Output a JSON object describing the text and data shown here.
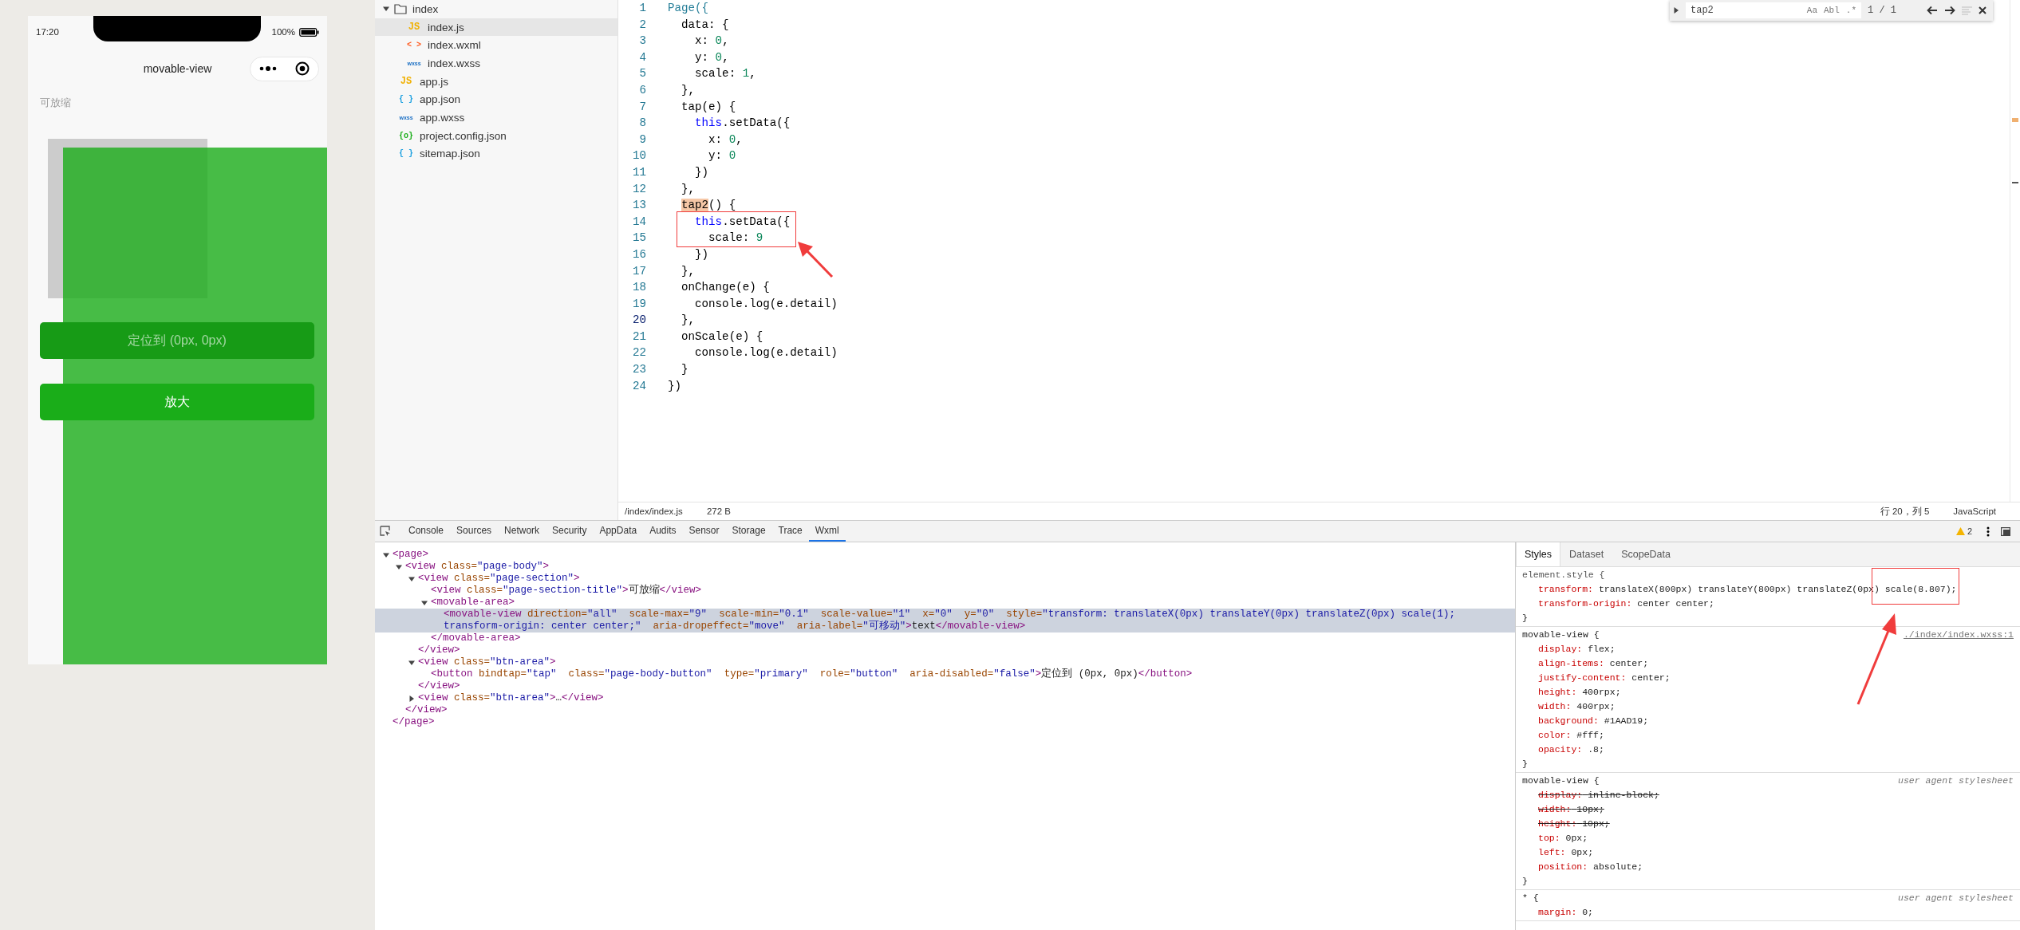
{
  "simulator": {
    "status_bar": {
      "time": "17:20",
      "battery": "100%"
    },
    "nav_title": "movable-view",
    "section_title": "可放缩",
    "buttons": [
      {
        "label": "定位到 (0px, 0px)",
        "pressed": true
      },
      {
        "label": "放大",
        "pressed": false
      }
    ]
  },
  "file_tree": [
    {
      "name": "index",
      "kind": "folder",
      "expanded": true,
      "selected": false,
      "children": [
        {
          "name": "index.js",
          "kind": "js",
          "glyph": "JS",
          "selected": true
        },
        {
          "name": "index.wxml",
          "kind": "wxml",
          "glyph": "< >",
          "selected": false
        },
        {
          "name": "index.wxss",
          "kind": "wxss",
          "glyph": "wxss",
          "selected": false
        }
      ]
    },
    {
      "name": "app.js",
      "kind": "js",
      "glyph": "JS",
      "selected": false
    },
    {
      "name": "app.json",
      "kind": "json",
      "glyph": "{ }",
      "selected": false
    },
    {
      "name": "app.wxss",
      "kind": "wxss",
      "glyph": "wxss",
      "selected": false
    },
    {
      "name": "project.config.json",
      "kind": "config",
      "glyph": "{o}",
      "selected": false
    },
    {
      "name": "sitemap.json",
      "kind": "json",
      "glyph": "{ }",
      "selected": false
    }
  ],
  "editor": {
    "lines": [
      {
        "number": "1",
        "current": false,
        "tokens": [
          {
            "kind": "type",
            "text": "Page({"
          }
        ]
      },
      {
        "number": "2",
        "current": false,
        "tokens": [
          {
            "kind": "plain",
            "text": "  data: {"
          }
        ]
      },
      {
        "number": "3",
        "current": false,
        "tokens": [
          {
            "kind": "plain",
            "text": "    x: "
          },
          {
            "kind": "number",
            "text": "0"
          },
          {
            "kind": "plain",
            "text": ","
          }
        ]
      },
      {
        "number": "4",
        "current": false,
        "tokens": [
          {
            "kind": "plain",
            "text": "    y: "
          },
          {
            "kind": "number",
            "text": "0"
          },
          {
            "kind": "plain",
            "text": ","
          }
        ]
      },
      {
        "number": "5",
        "current": false,
        "tokens": [
          {
            "kind": "plain",
            "text": "    scale: "
          },
          {
            "kind": "number",
            "text": "1"
          },
          {
            "kind": "plain",
            "text": ","
          }
        ]
      },
      {
        "number": "6",
        "current": false,
        "tokens": [
          {
            "kind": "plain",
            "text": "  },"
          }
        ]
      },
      {
        "number": "7",
        "current": false,
        "tokens": [
          {
            "kind": "plain",
            "text": "  tap(e) {"
          }
        ]
      },
      {
        "number": "8",
        "current": false,
        "tokens": [
          {
            "kind": "keyword",
            "text": "    this"
          },
          {
            "kind": "plain",
            "text": ".setData({"
          }
        ]
      },
      {
        "number": "9",
        "current": false,
        "tokens": [
          {
            "kind": "plain",
            "text": "      x: "
          },
          {
            "kind": "number",
            "text": "0"
          },
          {
            "kind": "plain",
            "text": ","
          }
        ]
      },
      {
        "number": "10",
        "current": false,
        "tokens": [
          {
            "kind": "plain",
            "text": "      y: "
          },
          {
            "kind": "number",
            "text": "0"
          }
        ]
      },
      {
        "number": "11",
        "current": false,
        "tokens": [
          {
            "kind": "plain",
            "text": "    })"
          }
        ]
      },
      {
        "number": "12",
        "current": false,
        "tokens": [
          {
            "kind": "plain",
            "text": "  },"
          }
        ]
      },
      {
        "number": "13",
        "current": false,
        "tokens": [
          {
            "kind": "match",
            "text": "  tap2"
          },
          {
            "kind": "plain",
            "text": "() {"
          }
        ]
      },
      {
        "number": "14",
        "current": false,
        "tokens": [
          {
            "kind": "keyword",
            "text": "    this"
          },
          {
            "kind": "plain",
            "text": ".setData({"
          }
        ]
      },
      {
        "number": "15",
        "current": false,
        "tokens": [
          {
            "kind": "plain",
            "text": "      scale: "
          },
          {
            "kind": "number",
            "text": "9"
          }
        ]
      },
      {
        "number": "16",
        "current": false,
        "tokens": [
          {
            "kind": "plain",
            "text": "    })"
          }
        ]
      },
      {
        "number": "17",
        "current": false,
        "tokens": [
          {
            "kind": "plain",
            "text": "  },"
          }
        ]
      },
      {
        "number": "18",
        "current": false,
        "tokens": [
          {
            "kind": "plain",
            "text": "  onChange(e) {"
          }
        ]
      },
      {
        "number": "19",
        "current": false,
        "tokens": [
          {
            "kind": "plain",
            "text": "    console.log(e.detail)"
          }
        ]
      },
      {
        "number": "20",
        "current": true,
        "tokens": [
          {
            "kind": "plain",
            "text": "  },"
          }
        ]
      },
      {
        "number": "21",
        "current": false,
        "tokens": [
          {
            "kind": "plain",
            "text": "  onScale(e) {"
          }
        ]
      },
      {
        "number": "22",
        "current": false,
        "tokens": [
          {
            "kind": "plain",
            "text": "    console.log(e.detail)"
          }
        ]
      },
      {
        "number": "23",
        "current": false,
        "tokens": [
          {
            "kind": "plain",
            "text": "  }"
          }
        ]
      },
      {
        "number": "24",
        "current": false,
        "tokens": [
          {
            "kind": "plain",
            "text": "})"
          }
        ]
      }
    ],
    "find": {
      "value": "tap2",
      "options": [
        "Aa",
        "Abl",
        ".*"
      ],
      "count": "1 / 1"
    },
    "status_bar": {
      "path": "/index/index.js",
      "size": "272 B",
      "position": "行 20，列 5",
      "language": "JavaScript"
    }
  },
  "devtools": {
    "tabs": [
      {
        "label": "Console",
        "selected": false
      },
      {
        "label": "Sources",
        "selected": false
      },
      {
        "label": "Network",
        "selected": false
      },
      {
        "label": "Security",
        "selected": false
      },
      {
        "label": "AppData",
        "selected": false
      },
      {
        "label": "Audits",
        "selected": false
      },
      {
        "label": "Sensor",
        "selected": false
      },
      {
        "label": "Storage",
        "selected": false
      },
      {
        "label": "Trace",
        "selected": false
      },
      {
        "label": "Wxml",
        "selected": true
      }
    ],
    "warnings": "2",
    "wxml": [
      {
        "kind": "branch",
        "markup": "<page>",
        "expanded": true,
        "selected": false,
        "closing": "</page>",
        "children": [
          {
            "kind": "branch",
            "markup": "<view class=\"page-body\">",
            "expanded": true,
            "selected": false,
            "closing": "</view>",
            "children": [
              {
                "kind": "branch",
                "markup": "<view class=\"page-section\">",
                "expanded": true,
                "selected": false,
                "closing": "</view>",
                "children": [
                  {
                    "kind": "leaf",
                    "markup": "<view class=\"page-section-title\">可放缩</view>",
                    "selected": false
                  },
                  {
                    "kind": "branch",
                    "markup": "<movable-area>",
                    "expanded": true,
                    "selected": false,
                    "closing": "</movable-area>",
                    "children": [
                      {
                        "kind": "leaf",
                        "markup": "<movable-view direction=\"all\"  scale-max=\"9\"  scale-min=\"0.1\"  scale-value=\"1\"  x=\"0\"  y=\"0\"  style=\"transform: translateX(0px) translateY(0px) translateZ(0px) scale(1); transform-origin: center center;\"  aria-dropeffect=\"move\"  aria-label=\"可移动\">text</movable-view>",
                        "selected": true
                      }
                    ]
                  }
                ]
              },
              {
                "kind": "branch",
                "markup": "<view class=\"btn-area\">",
                "expanded": true,
                "selected": false,
                "closing": "</view>",
                "children": [
                  {
                    "kind": "leaf",
                    "markup": "<button bindtap=\"tap\"  class=\"page-body-button\"  type=\"primary\"  role=\"button\"  aria-disabled=\"false\">定位到 (0px, 0px)</button>",
                    "selected": false
                  }
                ]
              },
              {
                "kind": "branch",
                "markup": "<view class=\"btn-area\">…</view>",
                "expanded": false,
                "selected": false
              }
            ]
          }
        ]
      }
    ],
    "styles": {
      "tabs": [
        {
          "label": "Styles",
          "selected": true
        },
        {
          "label": "Dataset",
          "selected": false
        },
        {
          "label": "ScopeData",
          "selected": false
        }
      ],
      "rules": [
        {
          "selector": "element.style {",
          "close": "}",
          "props": [
            {
              "name": "transform:",
              "value": "translateX(800px) translateY(800px) translateZ(0px) scale(8.807);",
              "struck": false
            },
            {
              "name": "transform-origin:",
              "value": "center center;",
              "struck": false
            }
          ]
        },
        {
          "selector": "movable-view {",
          "source": "./index/index.wxss:1",
          "kind": "link",
          "close": "}",
          "props": [
            {
              "name": "display:",
              "value": "flex;",
              "struck": false
            },
            {
              "name": "align-items:",
              "value": "center;",
              "struck": false
            },
            {
              "name": "justify-content:",
              "value": "center;",
              "struck": false
            },
            {
              "name": "height:",
              "value": "400rpx;",
              "struck": false
            },
            {
              "name": "width:",
              "value": "400rpx;",
              "struck": false
            },
            {
              "name": "background:",
              "value": "#1AAD19;",
              "struck": false
            },
            {
              "name": "color:",
              "value": "#fff;",
              "struck": false
            },
            {
              "name": "opacity:",
              "value": ".8;",
              "struck": false
            }
          ]
        },
        {
          "selector": "movable-view {",
          "source": "user agent stylesheet",
          "kind": "agent",
          "close": "}",
          "props": [
            {
              "name": "display:",
              "value": "inline-block;",
              "struck": true
            },
            {
              "name": "width:",
              "value": "10px;",
              "struck": true
            },
            {
              "name": "height:",
              "value": "10px;",
              "struck": true
            },
            {
              "name": "top:",
              "value": "0px;",
              "struck": false
            },
            {
              "name": "left:",
              "value": "0px;",
              "struck": false
            },
            {
              "name": "position:",
              "value": "absolute;",
              "struck": false
            }
          ]
        },
        {
          "selector": "* {",
          "source": "user agent stylesheet",
          "kind": "agent",
          "props": [
            {
              "name": "margin:",
              "value": "0;",
              "struck": false
            }
          ]
        }
      ]
    }
  }
}
